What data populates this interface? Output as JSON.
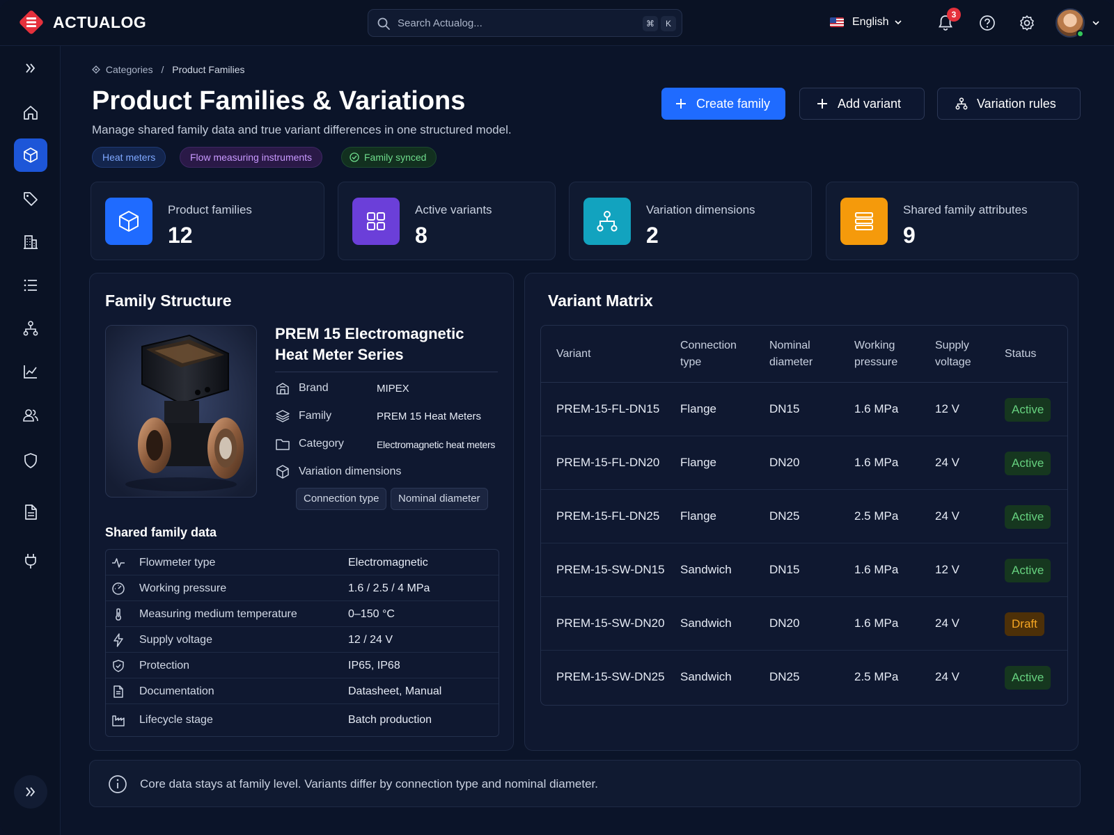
{
  "app": {
    "brand": "ACTUALOG",
    "search_placeholder": "Search Actualog...",
    "shortcut_keys": [
      "⌘",
      "K"
    ],
    "language": "English",
    "notification_count": "3"
  },
  "breadcrumb": [
    "Categories",
    "Product Families"
  ],
  "breadcrumb_sep": "/",
  "page": {
    "title": "Product Families & Variations",
    "subtitle": "Manage shared family data and true variant differences in one structured model.",
    "chips": [
      "Heat meters",
      "Flow measuring instruments",
      "Family synced"
    ]
  },
  "actions": {
    "create_family": "Create family",
    "add_variant": "Add variant",
    "variation_rules": "Variation rules"
  },
  "stats": [
    {
      "label": "Product families",
      "value": "12",
      "color": "#1f6bff",
      "icon": "cube-icon"
    },
    {
      "label": "Active variants",
      "value": "8",
      "color": "#6b3fd9",
      "icon": "grid-icon"
    },
    {
      "label": "Variation dimensions",
      "value": "2",
      "color": "#12a3bf",
      "icon": "hierarchy-icon"
    },
    {
      "label": "Shared family attributes",
      "value": "9",
      "color": "#f59a0b",
      "icon": "stack-icon"
    }
  ],
  "family": {
    "panel_title": "Family Structure",
    "product_title": "PREM 15 Electromagnetic Heat Meter Series",
    "props": [
      {
        "label": "Brand",
        "value": "MIPEX"
      },
      {
        "label": "Family",
        "value": "PREM 15 Heat Meters"
      },
      {
        "label": "Category",
        "value": "Electromagnetic heat meters"
      },
      {
        "label": "Variation dimensions",
        "value": ""
      }
    ],
    "dimension_chips": [
      "Connection type",
      "Nominal diameter"
    ],
    "shared_title": "Shared family data",
    "shared": [
      {
        "label": "Flowmeter type",
        "value": "Electromagnetic"
      },
      {
        "label": "Working pressure",
        "value": "1.6 / 2.5 / 4 MPa"
      },
      {
        "label": "Measuring medium temperature",
        "value": "0–150 °C"
      },
      {
        "label": "Supply voltage",
        "value": "12 / 24 V"
      },
      {
        "label": "Protection",
        "value": "IP65, IP68"
      },
      {
        "label": "Documentation",
        "value": "Datasheet, Manual"
      },
      {
        "label": "Lifecycle stage",
        "value": "Batch production"
      }
    ]
  },
  "matrix": {
    "panel_title": "Variant Matrix",
    "headers": [
      "Variant",
      "Connection type",
      "Nominal diameter",
      "Working pressure",
      "Supply voltage",
      "Status"
    ],
    "rows": [
      {
        "variant": "PREM-15-FL-DN15",
        "connection": "Flange",
        "diameter": "DN15",
        "pressure": "1.6 MPa",
        "voltage": "12 V",
        "status": "Active"
      },
      {
        "variant": "PREM-15-FL-DN20",
        "connection": "Flange",
        "diameter": "DN20",
        "pressure": "1.6 MPa",
        "voltage": "24 V",
        "status": "Active"
      },
      {
        "variant": "PREM-15-FL-DN25",
        "connection": "Flange",
        "diameter": "DN25",
        "pressure": "2.5 MPa",
        "voltage": "24 V",
        "status": "Active"
      },
      {
        "variant": "PREM-15-SW-DN15",
        "connection": "Sandwich",
        "diameter": "DN15",
        "pressure": "1.6 MPa",
        "voltage": "12 V",
        "status": "Active"
      },
      {
        "variant": "PREM-15-SW-DN20",
        "connection": "Sandwich",
        "diameter": "DN20",
        "pressure": "1.6 MPa",
        "voltage": "24 V",
        "status": "Draft"
      },
      {
        "variant": "PREM-15-SW-DN25",
        "connection": "Sandwich",
        "diameter": "DN25",
        "pressure": "2.5 MPa",
        "voltage": "24 V",
        "status": "Active"
      }
    ]
  },
  "info": "Core data stays at family level. Variants differ by connection type and nominal diameter.",
  "colors": {
    "accent": "#1f6bff",
    "active": "#66d17f",
    "draft": "#f5a623",
    "background": "#0b1429"
  }
}
